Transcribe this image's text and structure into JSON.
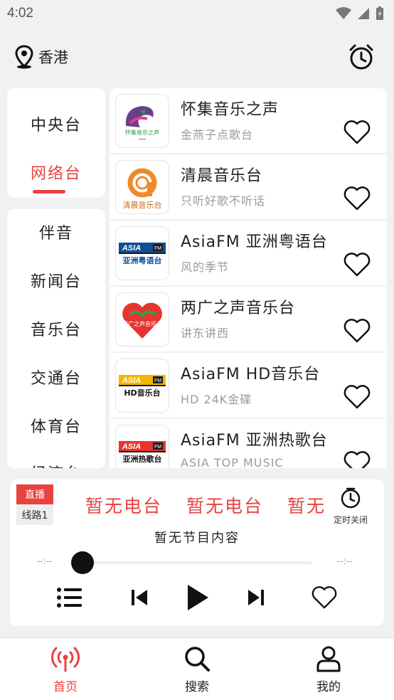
{
  "status_bar": {
    "time": "4:02"
  },
  "header": {
    "location": "香港"
  },
  "categories": {
    "top": [
      {
        "label": "中央台",
        "active": false
      },
      {
        "label": "网络台",
        "active": true
      }
    ],
    "bottom": [
      "伴音",
      "新闻台",
      "音乐台",
      "交通台",
      "体育台",
      "经济台"
    ]
  },
  "stations": [
    {
      "name": "怀集音乐之声",
      "desc": "金燕子点歌台",
      "logo_text": "怀集音乐之声"
    },
    {
      "name": "清晨音乐台",
      "desc": "只听好歌不听话",
      "logo_text": "清晨音乐台"
    },
    {
      "name": "AsiaFM 亚洲粤语台",
      "desc": "风的季节",
      "logo_text": "亚洲粤语台"
    },
    {
      "name": "两广之声音乐台",
      "desc": "讲东讲西",
      "logo_text": "两广之声音乐台"
    },
    {
      "name": "AsiaFM HD音乐台",
      "desc": "HD 24K金碟",
      "logo_text": "HD音乐台"
    },
    {
      "name": "AsiaFM 亚洲热歌台",
      "desc": "ASIA TOP MUSIC",
      "logo_text": "亚洲热歌台"
    }
  ],
  "player": {
    "live_label": "直播",
    "line_label": "线路1",
    "marquee": [
      "暂无电台",
      "暂无电台",
      "暂无电台"
    ],
    "timer_label": "定时关闭",
    "program": "暂无节目内容",
    "time_elapsed": "--:--",
    "time_total": "--:--",
    "progress": 0
  },
  "bottom_nav": [
    {
      "label": "首页",
      "icon": "radio-tower-icon",
      "active": true
    },
    {
      "label": "搜索",
      "icon": "search-icon",
      "active": false
    },
    {
      "label": "我的",
      "icon": "user-icon",
      "active": false
    }
  ],
  "colors": {
    "accent": "#e8423f",
    "background": "#f1f1f1"
  }
}
